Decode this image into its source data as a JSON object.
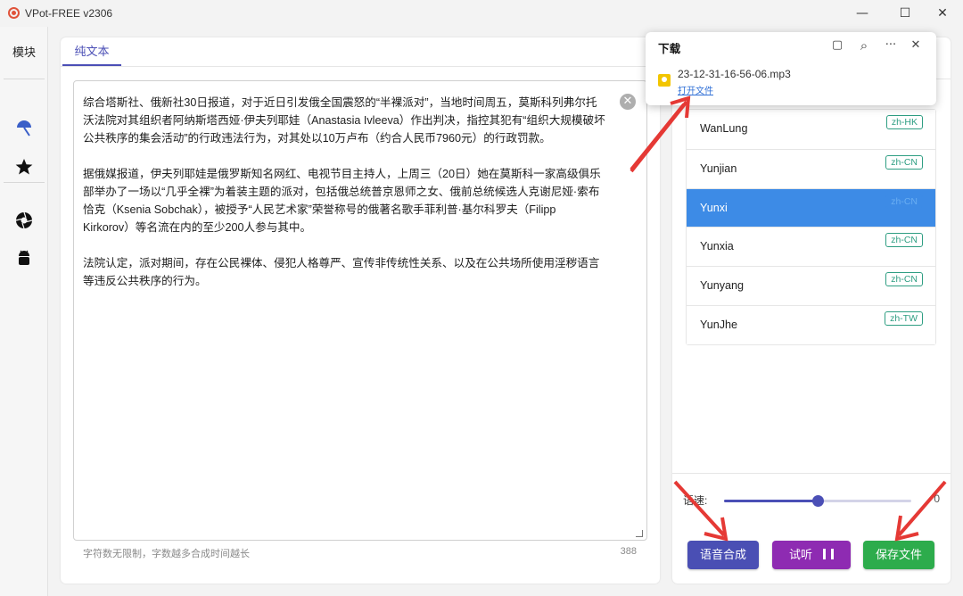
{
  "window": {
    "title": "VPot-FREE v2306",
    "minimize": "—",
    "maximize": "☐",
    "close": "✕"
  },
  "sidenav": {
    "title": "模块",
    "icons": [
      "umbrella-icon",
      "star-icon",
      "aperture-icon",
      "android-icon"
    ]
  },
  "editor": {
    "tab_label": "纯文本",
    "paragraphs": [
      "综合塔斯社、俄新社30日报道，对于近日引发俄全国震怒的“半裸派对”，当地时间周五，莫斯科列弗尔托沃法院对其组织者阿纳斯塔西娅·伊夫列耶娃（Anastasia Ivleeva）作出判决，指控其犯有“组织大规模破坏公共秩序的集会活动”的行政违法行为，对其处以10万卢布（约合人民币7960元）的行政罚款。",
      "据俄媒报道，伊夫列耶娃是俄罗斯知名网红、电视节目主持人，上周三（20日）她在莫斯科一家高级俱乐部举办了一场以“几乎全裸”为着装主题的派对，包括俄总统普京恩师之女、俄前总统候选人克谢尼娅·索布恰克（Ksenia Sobchak），被授予“人民艺术家”荣誉称号的俄著名歌手菲利普·基尔科罗夫（Filipp Kirkorov）等名流在内的至少200人参与其中。",
      "法院认定，派对期间，存在公民裸体、侵犯人格尊严、宣传非传统性关系、以及在公共场所使用淫秽语言等违反公共秩序的行为。"
    ],
    "clear_icon": "✕",
    "hint": "字符数无限制，字数越多合成时间越长",
    "char_count": "388"
  },
  "voices": {
    "items": [
      {
        "name": "WanLung",
        "tag": "zh-HK",
        "selected": false
      },
      {
        "name": "Yunjian",
        "tag": "zh-CN",
        "selected": false
      },
      {
        "name": "Yunxi",
        "tag": "zh-CN",
        "selected": true
      },
      {
        "name": "Yunxia",
        "tag": "zh-CN",
        "selected": false
      },
      {
        "name": "Yunyang",
        "tag": "zh-CN",
        "selected": false
      },
      {
        "name": "YunJhe",
        "tag": "zh-TW",
        "selected": false
      }
    ],
    "speed_label": "语速:",
    "speed_value": "0",
    "speed_fraction": 0.5
  },
  "buttons": {
    "synthesize": "语音合成",
    "listen": "试听",
    "save": "保存文件"
  },
  "download": {
    "title": "下载",
    "folder_icon": "▢",
    "search_icon": "⌕",
    "more_icon": "···",
    "close_icon": "✕",
    "filename": "23-12-31-16-56-06.mp3",
    "open_link": "打开文件"
  },
  "colors": {
    "accent": "#4b4fb6",
    "selected": "#3d8be6",
    "listen": "#8e2bb2",
    "save": "#2dac4c",
    "arrow": "#e53935"
  }
}
